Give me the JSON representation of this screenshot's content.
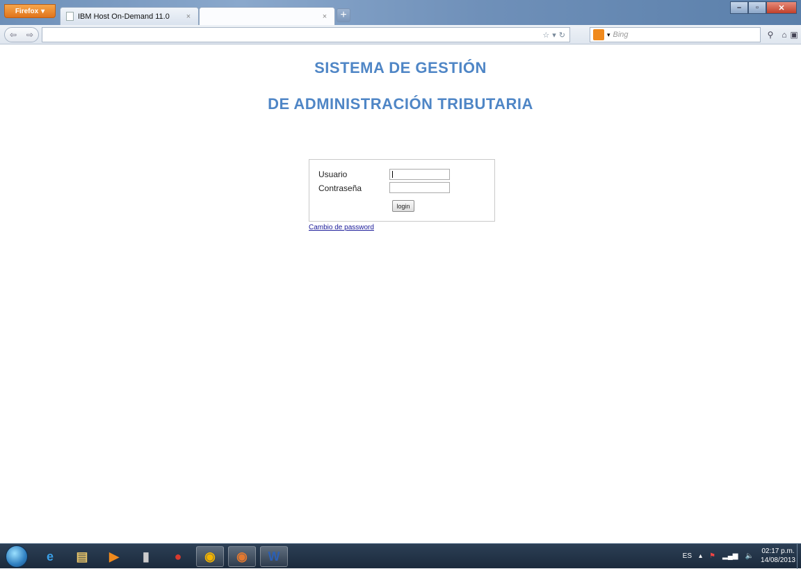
{
  "browser": {
    "menu_button": "Firefox",
    "tabs": [
      {
        "label": "IBM Host On-Demand 11.0",
        "active": false
      },
      {
        "label": "",
        "active": true
      }
    ],
    "new_tab": "+",
    "url": "",
    "search": {
      "engine": "Bing",
      "placeholder": "Bing"
    }
  },
  "page": {
    "title_line1": "SISTEMA DE GESTIÓN",
    "title_line2": "DE ADMINISTRACIÓN TRIBUTARIA",
    "title_color": "#4f86c6",
    "login": {
      "usuario_label": "Usuario",
      "usuario_value": "",
      "password_label": "Contraseña",
      "password_value": "",
      "button_label": "login"
    },
    "change_password_link": "Cambio de password"
  },
  "taskbar": {
    "apps": [
      {
        "name": "internet-explorer-icon",
        "glyph": "e",
        "color": "#3aa0e8"
      },
      {
        "name": "file-explorer-icon",
        "glyph": "▤",
        "color": "#e9c66a"
      },
      {
        "name": "media-player-icon",
        "glyph": "▶",
        "color": "#f08a1d"
      },
      {
        "name": "app-icon",
        "glyph": "▮",
        "color": "#cccccc"
      },
      {
        "name": "pdf-reader-icon",
        "glyph": "●",
        "color": "#d83a2e"
      },
      {
        "name": "chrome-icon",
        "glyph": "◉",
        "color": "#f4b400"
      },
      {
        "name": "firefox-icon",
        "glyph": "◉",
        "color": "#e5792f"
      },
      {
        "name": "word-icon",
        "glyph": "W",
        "color": "#2b5fb5"
      }
    ],
    "language": "ES",
    "time": "02:17 p.m.",
    "date": "14/08/2013"
  }
}
